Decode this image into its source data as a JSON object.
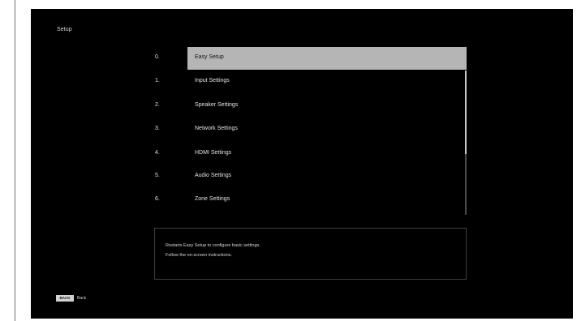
{
  "screen": {
    "title": "Setup"
  },
  "menu": {
    "items": [
      {
        "num": "0.",
        "label": "Easy Setup",
        "selected": true
      },
      {
        "num": "1.",
        "label": "Input Settings"
      },
      {
        "num": "2.",
        "label": "Speaker Settings"
      },
      {
        "num": "3.",
        "label": "Network Settings"
      },
      {
        "num": "4.",
        "label": "HDMI Settings"
      },
      {
        "num": "5.",
        "label": "Audio Settings"
      },
      {
        "num": "6.",
        "label": "Zone Settings"
      }
    ]
  },
  "description": {
    "line1": "Restarts Easy Setup to configure basic settings.",
    "line2": "Follow the on-screen instructions."
  },
  "footer": {
    "back_key": "BACK",
    "back_label": "Back"
  },
  "colors": {
    "background": "#000000",
    "highlight": "#b5b5b5",
    "text": "#e2e2e2"
  }
}
